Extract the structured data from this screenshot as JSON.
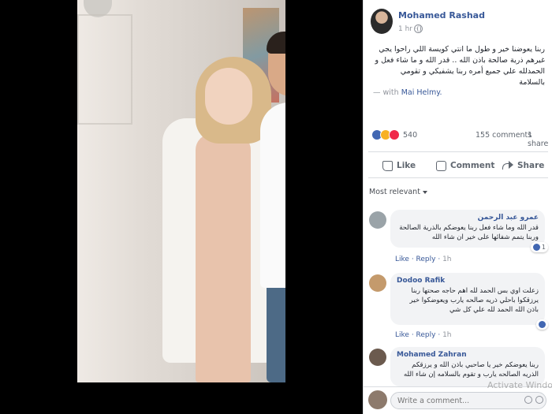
{
  "post": {
    "author": "Mohamed Rashad",
    "time": "1 hr ·",
    "text": "ربنا يعوضنا خير و طول ما انتي كويسة اللي راحوا يجي غيرهم ذرية صالحة باذن الله .. قدر الله و ما شاء فعل و الحمدلله علي جميع أمره ربنا يشفيكي و تقومي بالسلامة",
    "with_prefix": "— with ",
    "with_name": "Mai Helmy."
  },
  "stats": {
    "reactions": "540",
    "comments": "155 comments",
    "shares": "1 share"
  },
  "actions": {
    "like": "Like",
    "comment": "Comment",
    "share": "Share"
  },
  "filter": {
    "label": "Most relevant"
  },
  "comments": [
    {
      "name": "عمرو عبد الرحمن",
      "text": "قدر الله وما شاء فعل ربنا يعوضكم بالذرية الصالحة وربنا يتمم شفائها على خير ان شاء الله",
      "likes": "1",
      "like_label": "Like",
      "reply_label": "Reply",
      "time": "1h"
    },
    {
      "name": "Dodoo Rafik",
      "text": "زعلت اوي بس الحمد لله اهم حاجه صحتها ربنا يرزقكوا باحلي ذريه صالحه يارب ويعوضكوا خير باذن الله الحمد لله علي كل شي",
      "likes": "",
      "like_label": "Like",
      "reply_label": "Reply",
      "time": "1h"
    },
    {
      "name": "Mohamed Zahran",
      "text": "ربنا يعوضكم خير يا صاحبي باذن الله و يرزقكم الذريه الصالحه يارب و تقوم بالسلامه إن شاء الله"
    }
  ],
  "composer": {
    "placeholder": "Write a comment..."
  },
  "watermark": "Activate Windo",
  "colors": {
    "link": "#385898",
    "like_blue": "#4267b2",
    "love_red": "#f0284a",
    "sad_yellow": "#f7b125"
  }
}
